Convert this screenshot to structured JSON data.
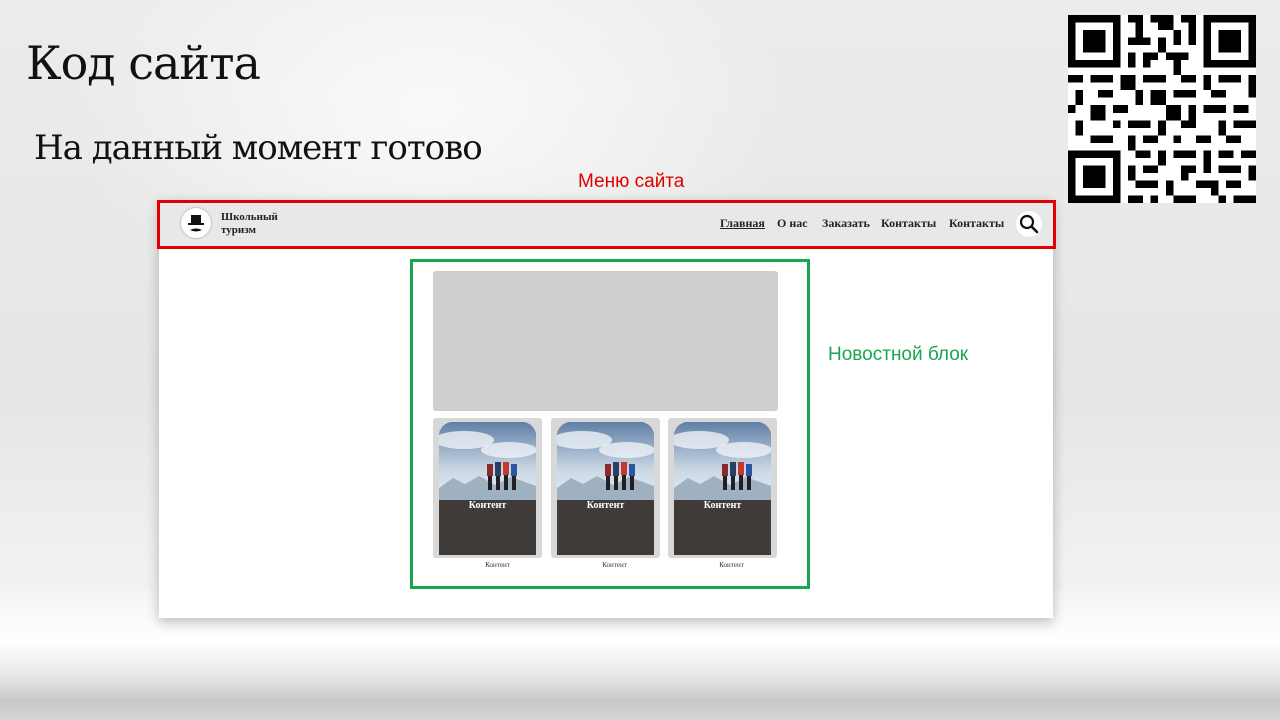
{
  "slide": {
    "title": "Код сайта",
    "subtitle": "На данный момент готово"
  },
  "annotations": {
    "menu_label": "Меню сайта",
    "news_label": "Новостной блок",
    "menu_color": "#e00000",
    "news_color": "#1aa651"
  },
  "site": {
    "brand": "Школьный туризм",
    "nav": [
      {
        "label": "Главная",
        "active": true
      },
      {
        "label": "О нас",
        "active": false
      },
      {
        "label": "Заказать",
        "active": false
      },
      {
        "label": "Контакты",
        "active": false
      },
      {
        "label": "Контакты",
        "active": false
      }
    ],
    "search_icon": "search-icon",
    "cards": [
      {
        "title": "Контент",
        "caption": "Контент"
      },
      {
        "title": "Контент",
        "caption": "Контент"
      },
      {
        "title": "Контент",
        "caption": "Контент"
      }
    ]
  }
}
